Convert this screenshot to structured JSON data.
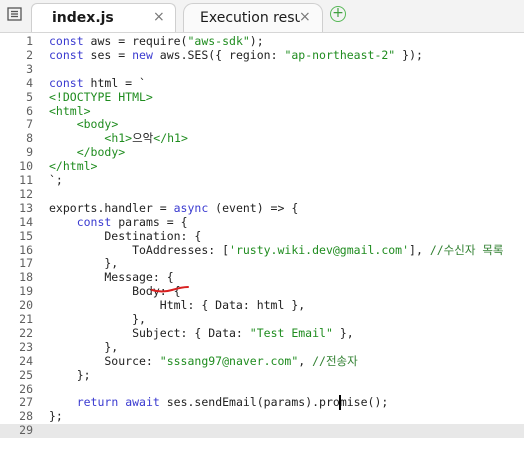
{
  "tabs": [
    {
      "label": "index.js",
      "close": "×"
    },
    {
      "label": "Execution results",
      "close": "×"
    }
  ],
  "add_tab": "+",
  "lines": [
    {
      "n": "1",
      "code": "const aws = require(\"aws-sdk\");"
    },
    {
      "n": "2",
      "code": "const ses = new aws.SES({ region: \"ap-northeast-2\" });"
    },
    {
      "n": "3",
      "code": ""
    },
    {
      "n": "4",
      "code": "const html = `"
    },
    {
      "n": "5",
      "code": "<!DOCTYPE HTML>"
    },
    {
      "n": "6",
      "code": "<html>"
    },
    {
      "n": "7",
      "code": "    <body>"
    },
    {
      "n": "8",
      "code": "        <h1>으악</h1>"
    },
    {
      "n": "9",
      "code": "    </body>"
    },
    {
      "n": "10",
      "code": "</html>"
    },
    {
      "n": "11",
      "code": "`;"
    },
    {
      "n": "12",
      "code": ""
    },
    {
      "n": "13",
      "code": "exports.handler = async (event) => {"
    },
    {
      "n": "14",
      "code": "    const params = {"
    },
    {
      "n": "15",
      "code": "        Destination: {"
    },
    {
      "n": "16",
      "code": "            ToAddresses: ['rusty.wiki.dev@gmail.com'], //수신자 목록"
    },
    {
      "n": "17",
      "code": "        },"
    },
    {
      "n": "18",
      "code": "        Message: {"
    },
    {
      "n": "19",
      "code": "            Body: {"
    },
    {
      "n": "20",
      "code": "                Html: { Data: html },"
    },
    {
      "n": "21",
      "code": "            },"
    },
    {
      "n": "22",
      "code": "            Subject: { Data: \"Test Email\" },"
    },
    {
      "n": "23",
      "code": "        },"
    },
    {
      "n": "24",
      "code": "        Source: \"sssang97@naver.com\", //전송자"
    },
    {
      "n": "25",
      "code": "    };"
    },
    {
      "n": "26",
      "code": ""
    },
    {
      "n": "27",
      "code": "    return await ses.sendEmail(params).promise();"
    },
    {
      "n": "28",
      "code": "};"
    },
    {
      "n": "29",
      "code": ""
    }
  ],
  "active_line": 29,
  "colors": {
    "keyword": "#3a3ad0",
    "string": "#1f8c1f",
    "annotation": "#d92020"
  }
}
